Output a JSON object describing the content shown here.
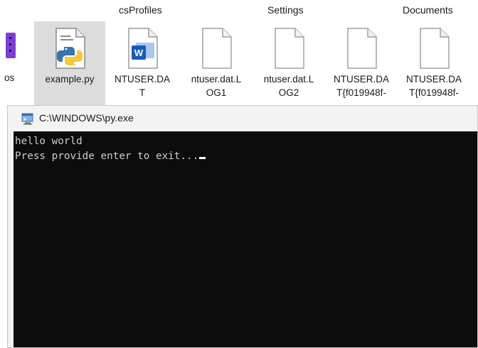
{
  "explorer": {
    "top_labels": {
      "profiles": "csProfiles",
      "settings": "Settings",
      "documents": "Documents"
    },
    "partial_left_label": "os",
    "files": [
      {
        "name": "example.py",
        "icon": "python-file-icon",
        "selected": true
      },
      {
        "name": "NTUSER.DAT",
        "icon": "word-file-icon",
        "selected": false
      },
      {
        "name": "ntuser.dat.LOG1",
        "icon": "blank-file-icon",
        "selected": false
      },
      {
        "name": "ntuser.dat.LOG2",
        "icon": "blank-file-icon",
        "selected": false
      },
      {
        "name": "NTUSER.DAT{f019948f-",
        "icon": "blank-file-icon",
        "selected": false
      },
      {
        "name": "NTUSER.DAT{f019948f-",
        "icon": "blank-file-icon",
        "selected": false
      }
    ],
    "file_name_lines": [
      [
        "example.py",
        ""
      ],
      [
        "NTUSER.DA",
        "T"
      ],
      [
        "ntuser.dat.L",
        "OG1"
      ],
      [
        "ntuser.dat.L",
        "OG2"
      ],
      [
        "NTUSER.DA",
        "T{f019948f-"
      ],
      [
        "NTUSER.DA",
        "T{f019948f-"
      ]
    ]
  },
  "console": {
    "title": "C:\\WINDOWS\\py.exe",
    "icon": "console-app-icon",
    "lines": [
      "hello world",
      "Press provide enter to exit..."
    ]
  },
  "colors": {
    "terminal_bg": "#0c0c0c",
    "terminal_text": "#cccccc",
    "selection": "#dcdcdc",
    "accent_purple": "#7b3fd2"
  }
}
